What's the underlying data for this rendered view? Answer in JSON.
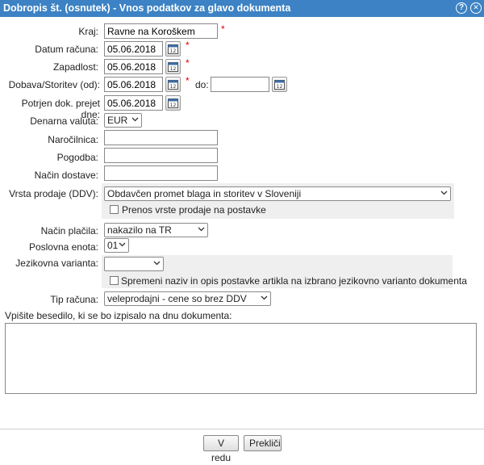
{
  "window": {
    "title": "Dobropis št. (osnutek) - Vnos podatkov za glavo dokumenta"
  },
  "fields": {
    "kraj": {
      "label": "Kraj:",
      "value": "Ravne na Koroškem"
    },
    "datum_racuna": {
      "label": "Datum računa:",
      "value": "05.06.2018"
    },
    "zapadlost": {
      "label": "Zapadlost:",
      "value": "05.06.2018"
    },
    "dobava": {
      "label": "Dobava/Storitev (od):",
      "value": "05.06.2018",
      "do_label": "do:",
      "do_value": ""
    },
    "potrjen": {
      "label": "Potrjen dok. prejet dne:",
      "value": "05.06.2018"
    },
    "valuta": {
      "label": "Denarna valuta:",
      "value": "EUR"
    },
    "narocilnica": {
      "label": "Naročilnica:",
      "value": ""
    },
    "pogodba": {
      "label": "Pogodba:",
      "value": ""
    },
    "nacin_dostave": {
      "label": "Način dostave:",
      "value": ""
    },
    "vrsta_prodaje": {
      "label": "Vrsta prodaje (DDV):",
      "value": "Obdavčen promet blaga in storitev v Sloveniji",
      "checkbox_label": "Prenos vrste prodaje na postavke"
    },
    "nacin_placila": {
      "label": "Način plačila:",
      "value": "nakazilo na TR"
    },
    "poslovna_enota": {
      "label": "Poslovna enota:",
      "value": "01"
    },
    "jezikovna_varianta": {
      "label": "Jezikovna varianta:",
      "value": "",
      "checkbox_label": "Spremeni naziv in opis postavke artikla na izbrano jezikovno varianto dokumenta"
    },
    "tip_racuna": {
      "label": "Tip računa:",
      "value": "veleprodajni - cene so brez DDV"
    }
  },
  "footer_text": {
    "label": "Vpišite besedilo, ki se bo izpisalo na dnu dokumenta:",
    "value": ""
  },
  "required_mark": "*",
  "buttons": {
    "ok": "V redu",
    "cancel": "Prekliči"
  }
}
